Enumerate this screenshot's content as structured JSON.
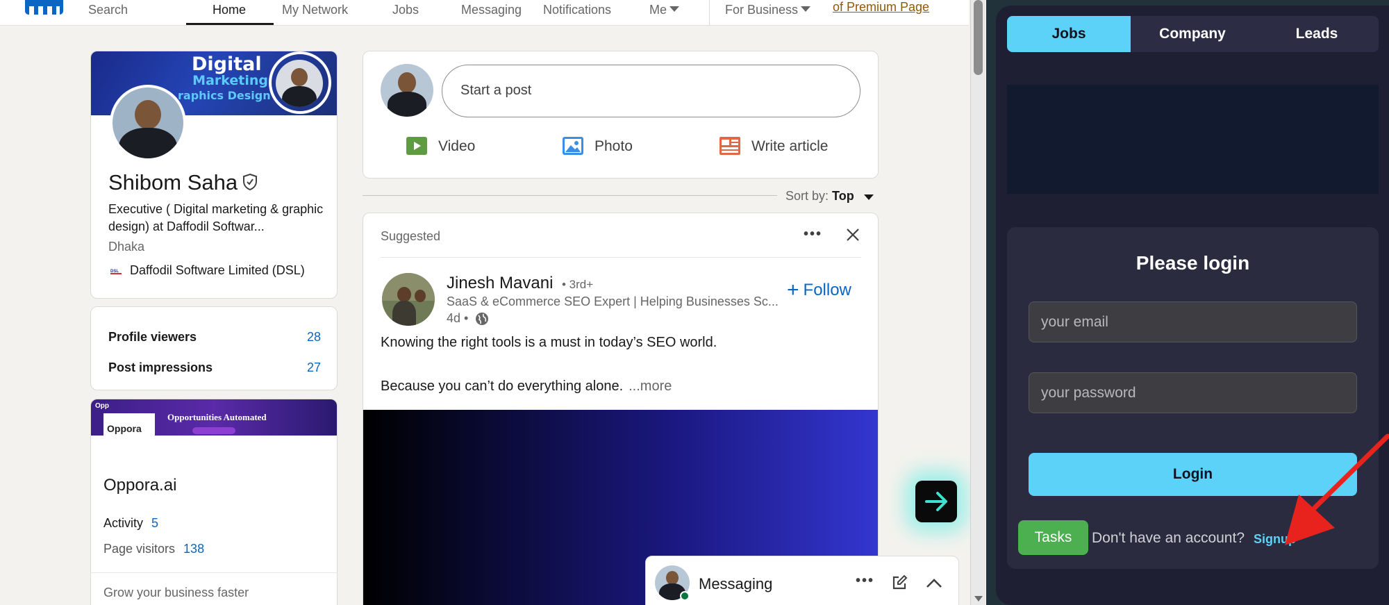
{
  "topnav": {
    "search_label": "Search",
    "items": [
      {
        "label": "Home",
        "active": true
      },
      {
        "label": "My Network"
      },
      {
        "label": "Jobs"
      },
      {
        "label": "Messaging"
      },
      {
        "label": "Notifications"
      },
      {
        "label": "Me"
      },
      {
        "label": "For Business"
      }
    ],
    "premium_link": "of Premium Page"
  },
  "profile": {
    "banner_line1": "Digital",
    "banner_line2": "Marketing",
    "banner_line3": "raphics Design",
    "name": "Shibom Saha",
    "headline": "Executive ( Digital marketing & graphic design) at Daffodil Softwar...",
    "location": "Dhaka",
    "company": "Daffodil Software Limited (DSL)"
  },
  "stats": {
    "profile_viewers_label": "Profile viewers",
    "profile_viewers_value": "28",
    "post_impressions_label": "Post impressions",
    "post_impressions_value": "27"
  },
  "oppora": {
    "banner_tag": "Opp",
    "banner_title": "Opportunities Automated",
    "logo_text": "Oppora",
    "name": "Oppora.ai",
    "activity_label": "Activity",
    "activity_value": "5",
    "visitors_label": "Page visitors",
    "visitors_value": "138",
    "cta": "Grow your business faster"
  },
  "share": {
    "start_post": "Start a post",
    "video": "Video",
    "photo": "Photo",
    "write_article": "Write article"
  },
  "sort": {
    "label": "Sort by:",
    "value": "Top"
  },
  "post": {
    "suggested": "Suggested",
    "author_name": "Jinesh Mavani",
    "author_degree": "• 3rd+",
    "author_headline": "SaaS & eCommerce SEO Expert | Helping Businesses Sc...",
    "time": "4d •",
    "follow": "Follow",
    "follow_plus": "+",
    "text_line1": "Knowing the right tools is a must in today’s SEO world.",
    "text_line2": "Because you can’t do everything alone.",
    "more": "...more"
  },
  "messaging": {
    "title": "Messaging"
  },
  "extension": {
    "tabs": [
      "Jobs",
      "Company",
      "Leads"
    ],
    "active_tab": "Jobs",
    "login_title": "Please login",
    "email_placeholder": "your email",
    "password_placeholder": "your password",
    "login_button": "Login",
    "tasks_button": "Tasks",
    "no_account": "Don't have an account?",
    "signup": "Signup"
  },
  "colors": {
    "linkedin_blue": "#0a66c2",
    "extension_accent": "#5dd2f8",
    "tasks_green": "#4caf50",
    "annotation_red": "#e8231d"
  }
}
